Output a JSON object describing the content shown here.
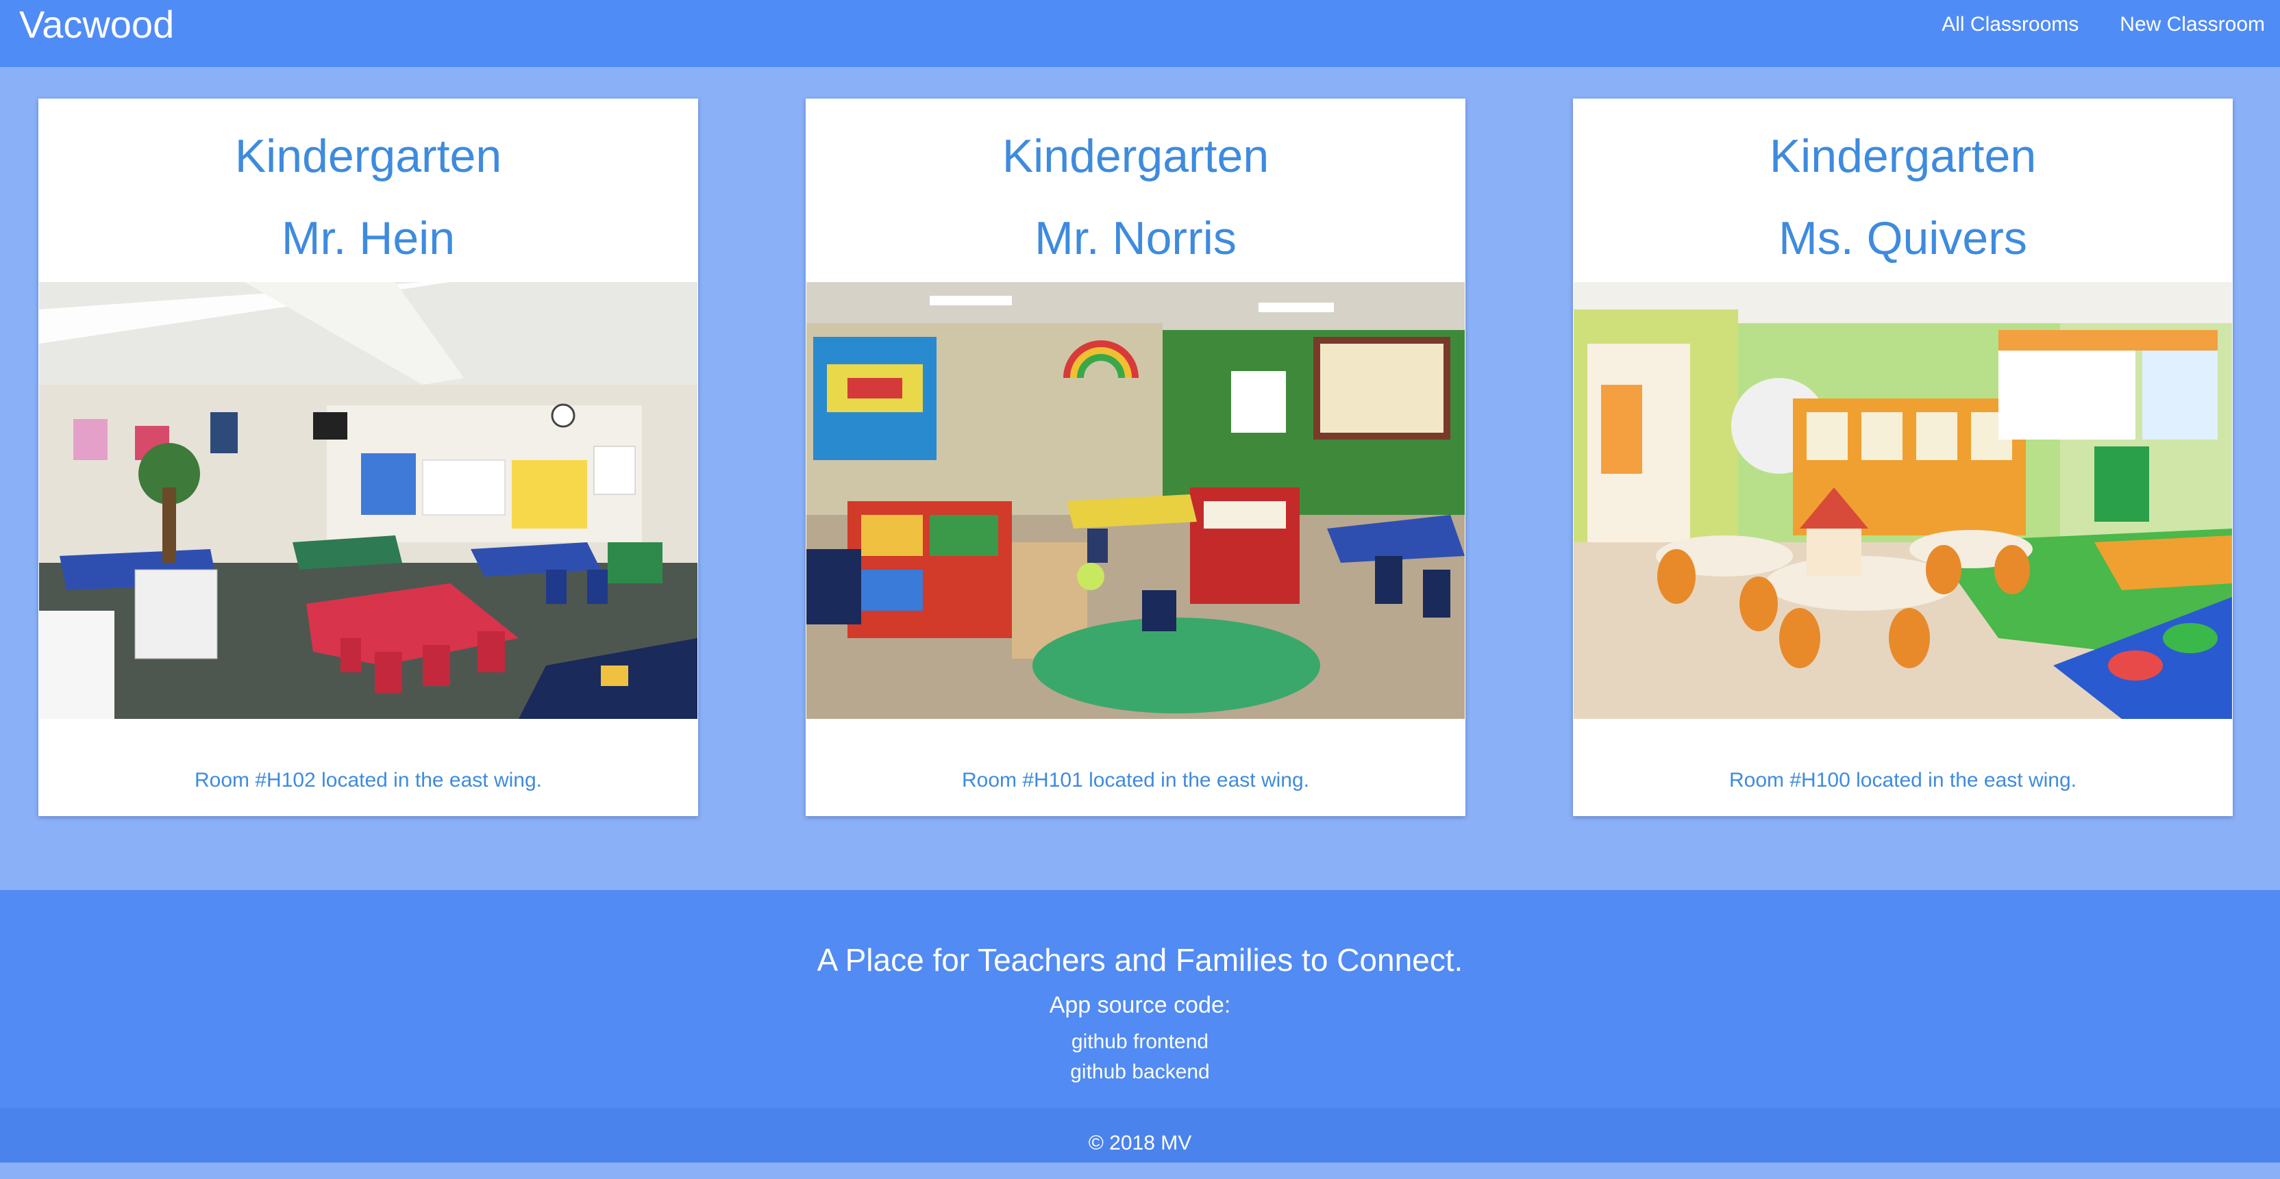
{
  "navbar": {
    "brand": "Vacwood",
    "links": [
      "All Classrooms",
      "New Classroom"
    ]
  },
  "classrooms": [
    {
      "grade": "Kindergarten",
      "teacher": "Mr. Hein",
      "description": "Room #H102 located in the east wing."
    },
    {
      "grade": "Kindergarten",
      "teacher": "Mr. Norris",
      "description": "Room #H101 located in the east wing."
    },
    {
      "grade": "Kindergarten",
      "teacher": "Ms. Quivers",
      "description": "Room #H100 located in the east wing."
    }
  ],
  "footer": {
    "tagline": "A Place for Teachers and Families to Connect.",
    "source_label": "App source code:",
    "links": [
      "github frontend",
      "github backend"
    ],
    "copyright": "© 2018 MV"
  },
  "colors": {
    "navbar": "#508cf6",
    "page_background": "#8ab0f8",
    "card_text": "#3e8bde",
    "footer": "#518bf3",
    "copyright_bar": "#4a83ec"
  },
  "icons": []
}
